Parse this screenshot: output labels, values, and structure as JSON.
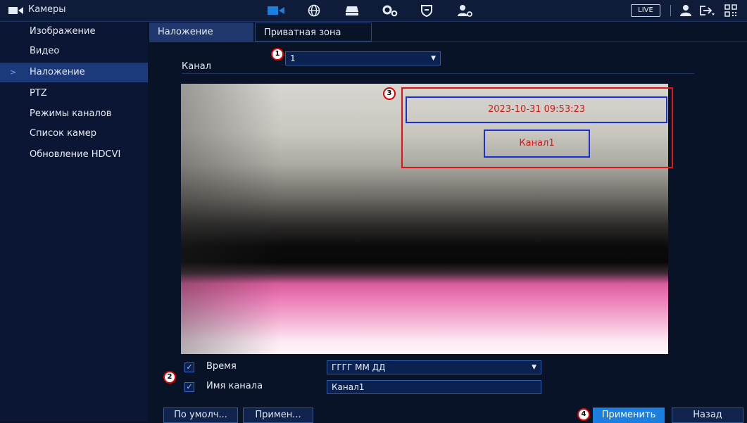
{
  "header": {
    "title": "Камеры",
    "icons": [
      "camera-icon",
      "network-icon",
      "storage-icon",
      "system-settings-icon",
      "security-icon",
      "account-settings-icon"
    ],
    "live_label": "LIVE"
  },
  "sidebar": {
    "items": [
      {
        "label": "Изображение"
      },
      {
        "label": "Видео"
      },
      {
        "label": "Наложение",
        "active": true
      },
      {
        "label": "PTZ"
      },
      {
        "label": "Режимы каналов"
      },
      {
        "label": "Список камер"
      },
      {
        "label": "Обновление HDCVI"
      }
    ]
  },
  "tabs": [
    {
      "label": "Наложение",
      "active": true
    },
    {
      "label": "Приватная зона",
      "active": false
    }
  ],
  "channel": {
    "label": "Канал",
    "value": "1"
  },
  "preview": {
    "time_overlay": "2023-10-31 09:53:23",
    "channel_overlay": "Канал1"
  },
  "callouts": [
    "1",
    "2",
    "3",
    "4"
  ],
  "settings": {
    "time": {
      "label": "Время",
      "checked": true,
      "format": "ГГГГ ММ ДД"
    },
    "channel_name": {
      "label": "Имя канала",
      "checked": true,
      "value": "Канал1"
    }
  },
  "buttons": {
    "default": "По умолч...",
    "copy": "Примен...",
    "apply": "Применить",
    "back": "Назад"
  },
  "colors": {
    "accent": "#1b7fe0",
    "active_item": "#1c3a7a",
    "overlay_text": "#d61a1a",
    "overlay_box": "#1a2fd6",
    "annotation": "#e01414"
  }
}
